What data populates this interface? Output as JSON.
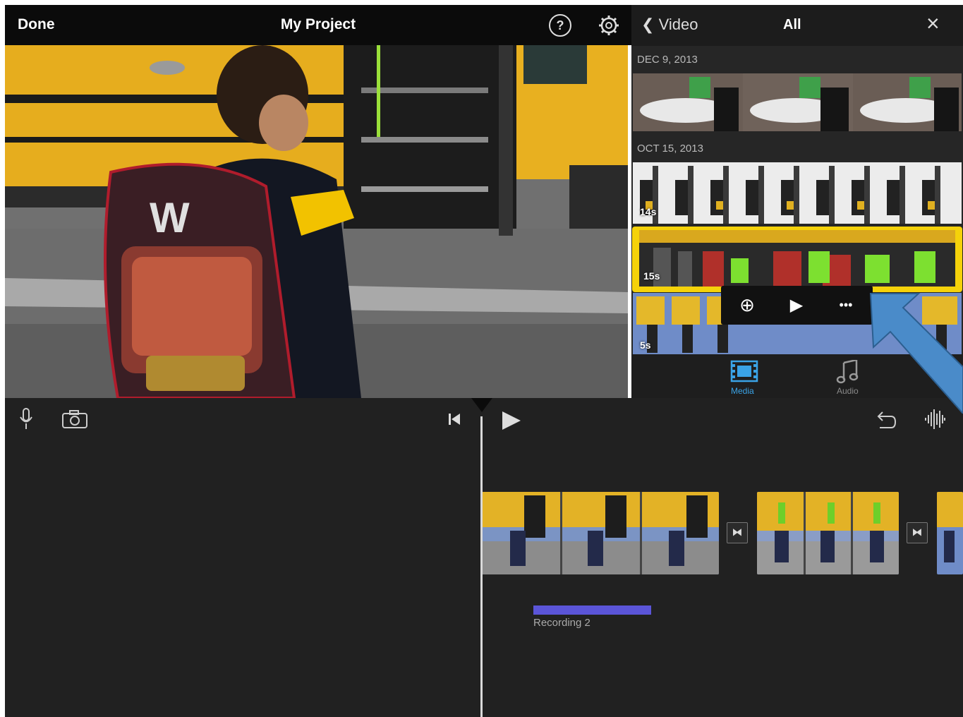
{
  "topbar": {
    "done_label": "Done",
    "title": "My Project",
    "help_glyph": "?",
    "icons": [
      "help-icon",
      "settings-icon"
    ]
  },
  "browser": {
    "back_label": "Video",
    "filter_label": "All",
    "close_glyph": "×",
    "groups": [
      {
        "date": "DEC 9, 2013"
      },
      {
        "date": "OCT 15, 2013"
      }
    ],
    "clips": [
      {
        "duration": "14s"
      },
      {
        "duration": "15s",
        "selected": true
      },
      {
        "duration": "5s"
      }
    ],
    "popup": {
      "icons": [
        "add-icon",
        "play-icon",
        "more-icon"
      ],
      "add_glyph": "⊕",
      "play_glyph": "▶",
      "more_glyph": "•••"
    },
    "tabs": [
      {
        "label": "Media",
        "icon": "film-icon",
        "active": true
      },
      {
        "label": "Audio",
        "icon": "music-note-icon",
        "active": false
      }
    ]
  },
  "timeline": {
    "tool_icons": [
      "microphone-icon",
      "camera-icon",
      "skip-to-start-icon",
      "play-icon",
      "undo-icon",
      "audio-waveform-icon"
    ],
    "transition_glyph": "⧓",
    "recording_label": "Recording 2"
  },
  "colors": {
    "accent_yellow": "#f5d20a",
    "media_tab_blue": "#3aa3e6",
    "recording_bar": "#5b55d8",
    "callout_arrow": "#4a8bc9"
  }
}
